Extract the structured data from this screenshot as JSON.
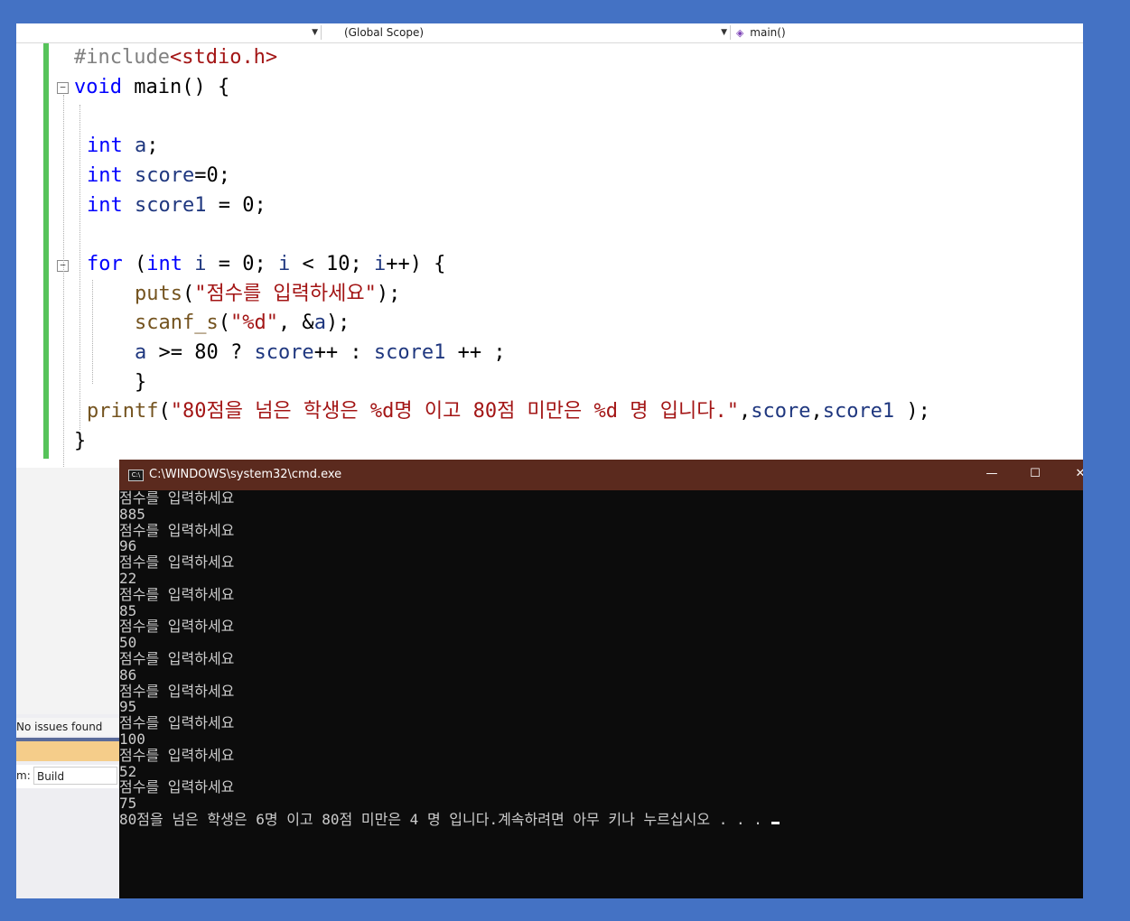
{
  "editor": {
    "nav": {
      "project_dropdown": "",
      "scope_dropdown": "(Global Scope)",
      "member_dropdown": "main()"
    },
    "code_lines": [
      {
        "tokens": [
          {
            "t": "#include",
            "c": "pp"
          },
          {
            "t": "<stdio.h>",
            "c": "str"
          }
        ]
      },
      {
        "tokens": [
          {
            "t": "void",
            "c": "kw"
          },
          {
            "t": " main() {",
            "c": ""
          }
        ]
      },
      {
        "tokens": []
      },
      {
        "tokens": [
          {
            "t": "int",
            "c": "kw"
          },
          {
            "t": " ",
            "c": ""
          },
          {
            "t": "a",
            "c": "id"
          },
          {
            "t": ";",
            "c": ""
          }
        ]
      },
      {
        "tokens": [
          {
            "t": "int",
            "c": "kw"
          },
          {
            "t": " ",
            "c": ""
          },
          {
            "t": "score",
            "c": "id"
          },
          {
            "t": "=0;",
            "c": ""
          }
        ]
      },
      {
        "tokens": [
          {
            "t": "int",
            "c": "kw"
          },
          {
            "t": " ",
            "c": ""
          },
          {
            "t": "score1",
            "c": "id"
          },
          {
            "t": " = 0;",
            "c": ""
          }
        ]
      },
      {
        "tokens": []
      },
      {
        "tokens": [
          {
            "t": "for",
            "c": "kw"
          },
          {
            "t": " (",
            "c": ""
          },
          {
            "t": "int",
            "c": "kw"
          },
          {
            "t": " ",
            "c": ""
          },
          {
            "t": "i",
            "c": "id"
          },
          {
            "t": " = 0; ",
            "c": ""
          },
          {
            "t": "i",
            "c": "id"
          },
          {
            "t": " < 10; ",
            "c": ""
          },
          {
            "t": "i",
            "c": "id"
          },
          {
            "t": "++) {",
            "c": ""
          }
        ]
      },
      {
        "tokens": [
          {
            "t": "    ",
            "c": ""
          },
          {
            "t": "puts",
            "c": "fn"
          },
          {
            "t": "(",
            "c": ""
          },
          {
            "t": "\"점수를 입력하세요\"",
            "c": "str"
          },
          {
            "t": ");",
            "c": ""
          }
        ]
      },
      {
        "tokens": [
          {
            "t": "    ",
            "c": ""
          },
          {
            "t": "scanf_s",
            "c": "fn"
          },
          {
            "t": "(",
            "c": ""
          },
          {
            "t": "\"%d\"",
            "c": "str"
          },
          {
            "t": ", &",
            "c": ""
          },
          {
            "t": "a",
            "c": "id"
          },
          {
            "t": ");",
            "c": ""
          }
        ]
      },
      {
        "tokens": [
          {
            "t": "    ",
            "c": ""
          },
          {
            "t": "a",
            "c": "id"
          },
          {
            "t": " >= 80 ? ",
            "c": ""
          },
          {
            "t": "score",
            "c": "id"
          },
          {
            "t": "++ : ",
            "c": ""
          },
          {
            "t": "score1",
            "c": "id"
          },
          {
            "t": " ++ ;",
            "c": ""
          }
        ]
      },
      {
        "tokens": [
          {
            "t": "    }",
            "c": ""
          }
        ]
      },
      {
        "tokens": [
          {
            "t": "printf",
            "c": "fn"
          },
          {
            "t": "(",
            "c": ""
          },
          {
            "t": "\"80점을 넘은 학생은 %d명 이고 80점 미만은 %d 명 입니다.\"",
            "c": "str"
          },
          {
            "t": ",",
            "c": ""
          },
          {
            "t": "score",
            "c": "id"
          },
          {
            "t": ",",
            "c": ""
          },
          {
            "t": "score1",
            "c": "id"
          },
          {
            "t": " );",
            "c": ""
          }
        ]
      },
      {
        "tokens": [
          {
            "t": "}",
            "c": ""
          }
        ]
      }
    ],
    "bottom_panel": {
      "issues_text": "No issues found",
      "output_from_label": "m:",
      "output_from_value": "Build"
    }
  },
  "console": {
    "title": "C:\\WINDOWS\\system32\\cmd.exe",
    "minimize_glyph": "—",
    "maximize_glyph": "☐",
    "close_glyph": "✕",
    "lines": [
      "점수를 입력하세요",
      "885",
      "점수를 입력하세요",
      "96",
      "점수를 입력하세요",
      "22",
      "점수를 입력하세요",
      "85",
      "점수를 입력하세요",
      "50",
      "점수를 입력하세요",
      "86",
      "점수를 입력하세요",
      "95",
      "점수를 입력하세요",
      "100",
      "점수를 입력하세요",
      "52",
      "점수를 입력하세요",
      "75",
      "80점을 넘은 학생은 6명 이고 80점 미만은 4 명 입니다.계속하려면 아무 키나 누르십시오 . . ."
    ]
  },
  "colors": {
    "desktop": "#4472c4",
    "console_titlebar": "#5b2a1e",
    "console_bg": "#0c0c0c",
    "change_bar": "#56c35a"
  }
}
